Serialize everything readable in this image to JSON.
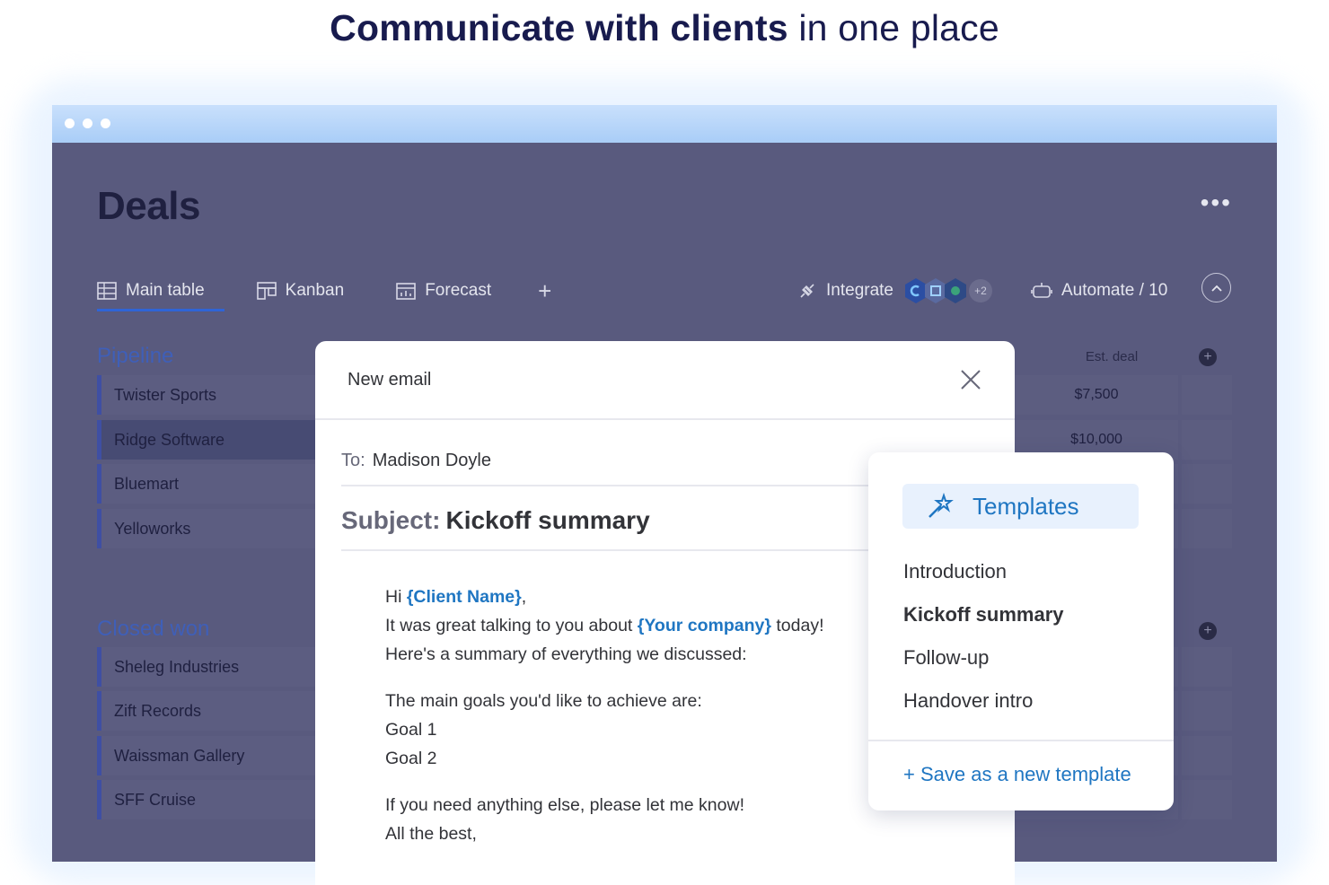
{
  "headline": {
    "bold": "Communicate with clients",
    "light": "in one place"
  },
  "board": {
    "title": "Deals",
    "more": "•••",
    "tabs": [
      {
        "label": "Main table",
        "icon": "table-icon"
      },
      {
        "label": "Kanban",
        "icon": "kanban-icon"
      },
      {
        "label": "Forecast",
        "icon": "forecast-icon"
      }
    ],
    "add_tab": "+",
    "integrate": {
      "label": "Integrate",
      "extra": "+2"
    },
    "automate": {
      "label": "Automate / 10"
    },
    "column_header": "Est. deal",
    "add_column": "+",
    "groups": [
      {
        "title": "Pipeline",
        "rows": [
          "Twister Sports",
          "Ridge Software",
          "Bluemart",
          "Yelloworks"
        ],
        "values": [
          "$7,500",
          "$10,000",
          "",
          ""
        ]
      },
      {
        "title": "Closed won",
        "rows": [
          "Sheleg Industries",
          "Zift Records",
          "Waissman Gallery",
          "SFF Cruise"
        ]
      }
    ]
  },
  "email": {
    "header": "New email",
    "to_label": "To:",
    "to_value": "Madison Doyle",
    "subject_label": "Subject:",
    "subject_value": "Kickoff summary",
    "greeting_prefix": "Hi ",
    "client_var": "{Client Name}",
    "greeting_suffix": ",",
    "line2_prefix": "It was great talking to you about ",
    "company_var": "{Your company}",
    "line2_suffix": " today!",
    "line3": "Here's a summary of everything we discussed:",
    "line4": "The main goals you'd like to achieve are:",
    "goal1": "Goal 1",
    "goal2": "Goal 2",
    "line5": "If you need anything else, please let me know!",
    "line6": "All the best,"
  },
  "templates": {
    "button": "Templates",
    "items": [
      "Introduction",
      "Kickoff summary",
      "Follow-up",
      "Handover intro"
    ],
    "selected": "Kickoff summary",
    "save": "+ Save as a new template"
  },
  "colors": {
    "headline": "#181b4e",
    "overlay": "#595a7e",
    "accent_blue": "#1f76c2",
    "group_blue": "#3f5fb8"
  }
}
